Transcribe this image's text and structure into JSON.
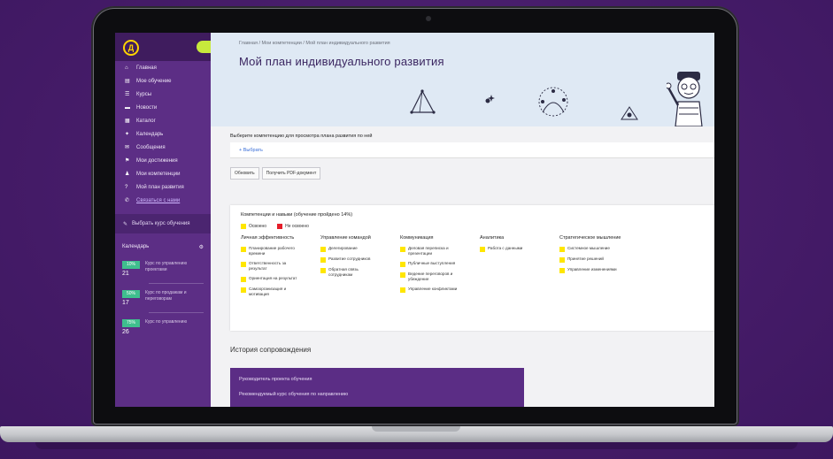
{
  "colors": {
    "background": "#4a1f6e",
    "sidebar": "#5c2e85",
    "hero": "#dfe9f4",
    "accent": "#ffd400",
    "skill_marker": "#ffe600",
    "alert_marker": "#e51e2a",
    "calendar_tag": "#3fbf8e"
  },
  "sidebar": {
    "logo": "Д",
    "items": [
      {
        "icon": "home-icon",
        "glyph": "⌂",
        "label": "Главная"
      },
      {
        "icon": "book-icon",
        "glyph": "▤",
        "label": "Мое обучение"
      },
      {
        "icon": "list-icon",
        "glyph": "☰",
        "label": "Курсы"
      },
      {
        "icon": "news-icon",
        "glyph": "▬",
        "label": "Новости"
      },
      {
        "icon": "library-icon",
        "glyph": "▦",
        "label": "Каталог"
      },
      {
        "icon": "pin-icon",
        "glyph": "✦",
        "label": "Календарь"
      },
      {
        "icon": "chat-icon",
        "glyph": "✉",
        "label": "Сообщения"
      },
      {
        "icon": "flag-icon",
        "glyph": "⚑",
        "label": "Мои достижения"
      },
      {
        "icon": "person-icon",
        "glyph": "♟",
        "label": "Мои компетенции"
      },
      {
        "icon": "help-icon",
        "glyph": "?",
        "label": "Мой план развития"
      },
      {
        "icon": "support-icon",
        "glyph": "✆",
        "label": "Связаться с нами"
      }
    ],
    "section": "Выбрать курс обучения",
    "calendar_label": "Календарь",
    "calendar": [
      {
        "tag": "10%",
        "day": "21",
        "text": "Курс по управлению проектами"
      },
      {
        "tag": "50%",
        "day": "17",
        "text": "Курс по продажам и переговорам"
      },
      {
        "tag": "75%",
        "day": "26",
        "text": "Курс по управлению"
      }
    ]
  },
  "hero": {
    "breadcrumb": "Главная / Мои компетенции / Мой план индивидуального развития",
    "title": "Мой план индивидуального развития"
  },
  "form": {
    "label": "Выберите компетенцию для просмотра плана развития по ней",
    "select_value": "+ Выбрать",
    "buttons": [
      "Обновить",
      "Получить PDF-документ"
    ]
  },
  "competencies": {
    "title": "Компетенции и навыки (обучение пройдено 14%)",
    "legend": [
      "Освоено",
      "Не освоено"
    ],
    "columns": [
      {
        "heading": "Личная эффективность",
        "skills": [
          "Планирование рабочего времени",
          "Ответственность за результат",
          "Ориентация на результат",
          "Самоорганизация и мотивация"
        ]
      },
      {
        "heading": "Управление командой",
        "skills": [
          "Делегирование",
          "Развитие сотрудников",
          "Обратная связь сотрудникам"
        ]
      },
      {
        "heading": "Коммуникация",
        "skills": [
          "Деловая переписка и презентации",
          "Публичные выступления",
          "Ведение переговоров и убеждение",
          "Управление конфликтами"
        ]
      },
      {
        "heading": "Аналитика",
        "skills": [
          "Работа с данными"
        ]
      },
      {
        "heading": "Стратегическое мышление",
        "skills": [
          "Системное мышление",
          "Принятие решений",
          "Управление изменениями"
        ]
      }
    ]
  },
  "history": {
    "heading": "История сопровождения",
    "lines": [
      "Руководитель проекта обучения",
      "Рекомендуемый курс обучения по направлению"
    ]
  }
}
